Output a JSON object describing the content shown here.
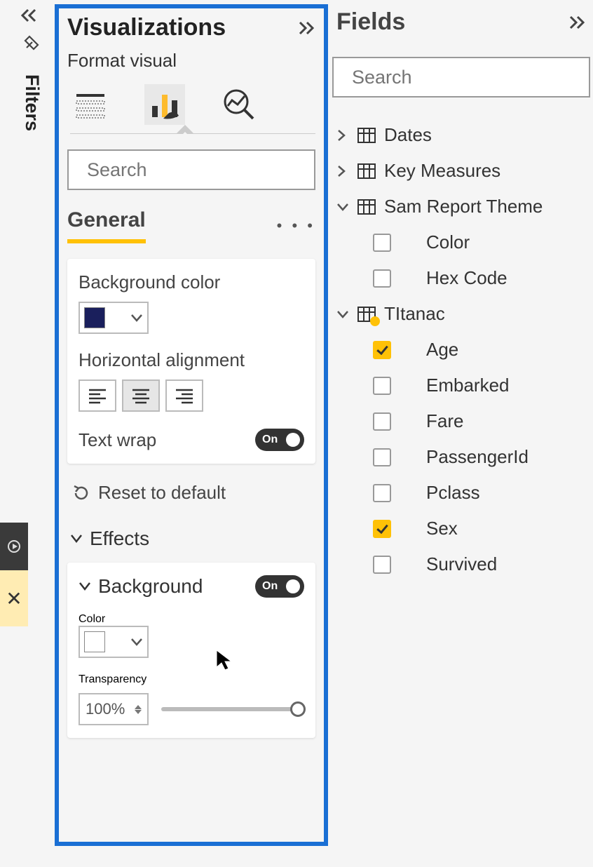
{
  "filters": {
    "label": "Filters"
  },
  "viz": {
    "title": "Visualizations",
    "subtitle": "Format visual",
    "search_placeholder": "Search",
    "tabs": {
      "general": "General"
    },
    "bgcolor": {
      "label": "Background color",
      "value": "#1a1f5c"
    },
    "halign": {
      "label": "Horizontal alignment",
      "selected": "center"
    },
    "textwrap": {
      "label": "Text wrap",
      "state": "On"
    },
    "reset": "Reset to default",
    "effects": {
      "label": "Effects"
    },
    "background": {
      "label": "Background",
      "state": "On"
    },
    "color": {
      "label": "Color",
      "value": "#ffffff"
    },
    "transparency": {
      "label": "Transparency",
      "value": "100%"
    }
  },
  "fields": {
    "title": "Fields",
    "search_placeholder": "Search",
    "tables": [
      {
        "name": "Dates",
        "expanded": false
      },
      {
        "name": "Key Measures",
        "expanded": false
      },
      {
        "name": "Sam Report Theme",
        "expanded": true,
        "fields": [
          {
            "name": "Color",
            "checked": false
          },
          {
            "name": "Hex Code",
            "checked": false
          }
        ]
      },
      {
        "name": "TItanac",
        "expanded": true,
        "badge": true,
        "fields": [
          {
            "name": "Age",
            "checked": true
          },
          {
            "name": "Embarked",
            "checked": false
          },
          {
            "name": "Fare",
            "checked": false
          },
          {
            "name": "PassengerId",
            "checked": false
          },
          {
            "name": "Pclass",
            "checked": false
          },
          {
            "name": "Sex",
            "checked": true
          },
          {
            "name": "Survived",
            "checked": false
          }
        ]
      }
    ]
  }
}
